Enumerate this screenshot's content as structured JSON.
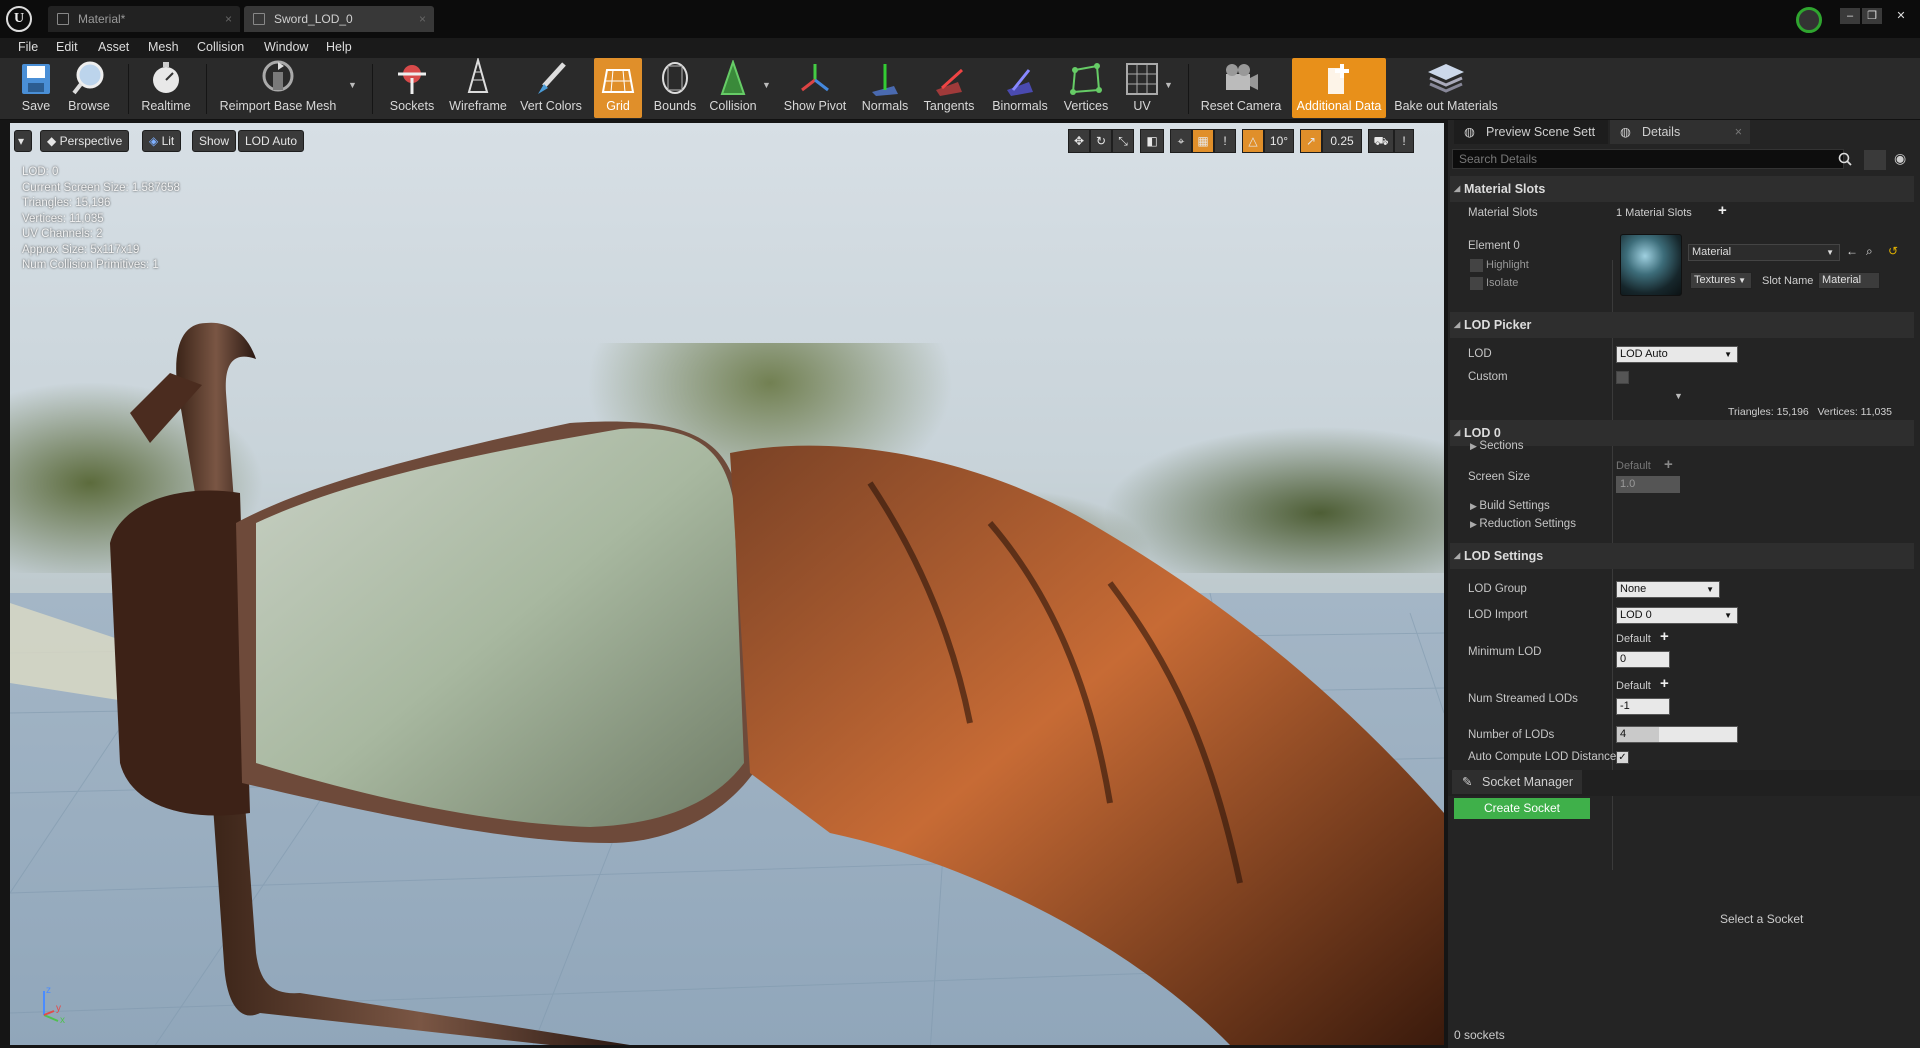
{
  "app": {
    "logo_text": "U"
  },
  "tabs": [
    {
      "label": "Material*"
    },
    {
      "label": "Sword_LOD_0"
    }
  ],
  "window_controls": {
    "minimize": "–",
    "restore": "❐",
    "close": "✕"
  },
  "menu": [
    "File",
    "Edit",
    "Asset",
    "Mesh",
    "Collision",
    "Window",
    "Help"
  ],
  "toolbar": {
    "save": "Save",
    "browse": "Browse",
    "realtime": "Realtime",
    "reimport": "Reimport Base Mesh",
    "sockets": "Sockets",
    "wireframe": "Wireframe",
    "vert_colors": "Vert Colors",
    "grid": "Grid",
    "bounds": "Bounds",
    "collision": "Collision",
    "show_pivot": "Show Pivot",
    "normals": "Normals",
    "tangents": "Tangents",
    "binormals": "Binormals",
    "vertices": "Vertices",
    "uv": "UV",
    "reset_camera": "Reset Camera",
    "additional_data": "Additional Data",
    "bake_out": "Bake out Materials"
  },
  "viewport": {
    "perspective": "Perspective",
    "lit": "Lit",
    "show": "Show",
    "lod_auto": "LOD Auto",
    "stats": [
      "LOD:  0",
      "Current Screen Size:  1.587658",
      "Triangles:  15,196",
      "Vertices:  11,035",
      "UV Channels:  2",
      "Approx Size: 5x117x19",
      "Num Collision Primitives:  1"
    ],
    "angle_snap": "10°",
    "scale_snap": "0.25",
    "warn": "!",
    "axis_z": "z",
    "axis_x": "x",
    "axis_y": "y"
  },
  "panel": {
    "tab_preview": "Preview Scene Sett",
    "tab_details": "Details",
    "search_placeholder": "Search Details",
    "material_slots": {
      "header": "Material Slots",
      "label": "Material Slots",
      "value": "1 Material Slots",
      "element": "Element 0",
      "highlight": "Highlight",
      "isolate": "Isolate",
      "material": "Material",
      "textures": "Textures",
      "slot_name_label": "Slot Name",
      "slot_name": "Material"
    },
    "lod_picker": {
      "header": "LOD Picker",
      "lod_label": "LOD",
      "lod_value": "LOD Auto",
      "custom": "Custom"
    },
    "lod0": {
      "stats": "Triangles: 15,196   Vertices: 11,035",
      "header": "LOD 0",
      "sections": "Sections",
      "screen_size": "Screen Size",
      "default": "Default",
      "screen_value": "1.0",
      "build": "Build Settings",
      "reduction": "Reduction Settings"
    },
    "lod_settings": {
      "header": "LOD Settings",
      "group_label": "LOD Group",
      "group_value": "None",
      "import_label": "LOD Import",
      "import_value": "LOD 0",
      "min_label": "Minimum LOD",
      "default": "Default",
      "min_value": "0",
      "streamed_label": "Num Streamed LODs",
      "streamed_value": "-1",
      "number_label": "Number of LODs",
      "number_value": "4",
      "auto_label": "Auto Compute LOD Distance"
    },
    "socket_manager": {
      "tab": "Socket Manager",
      "create": "Create Socket",
      "select": "Select a Socket",
      "count": "0 sockets"
    }
  },
  "colors": {
    "accent_orange": "#e08f2a",
    "create_green": "#3fb04a",
    "source_control": "#2fa52f"
  }
}
